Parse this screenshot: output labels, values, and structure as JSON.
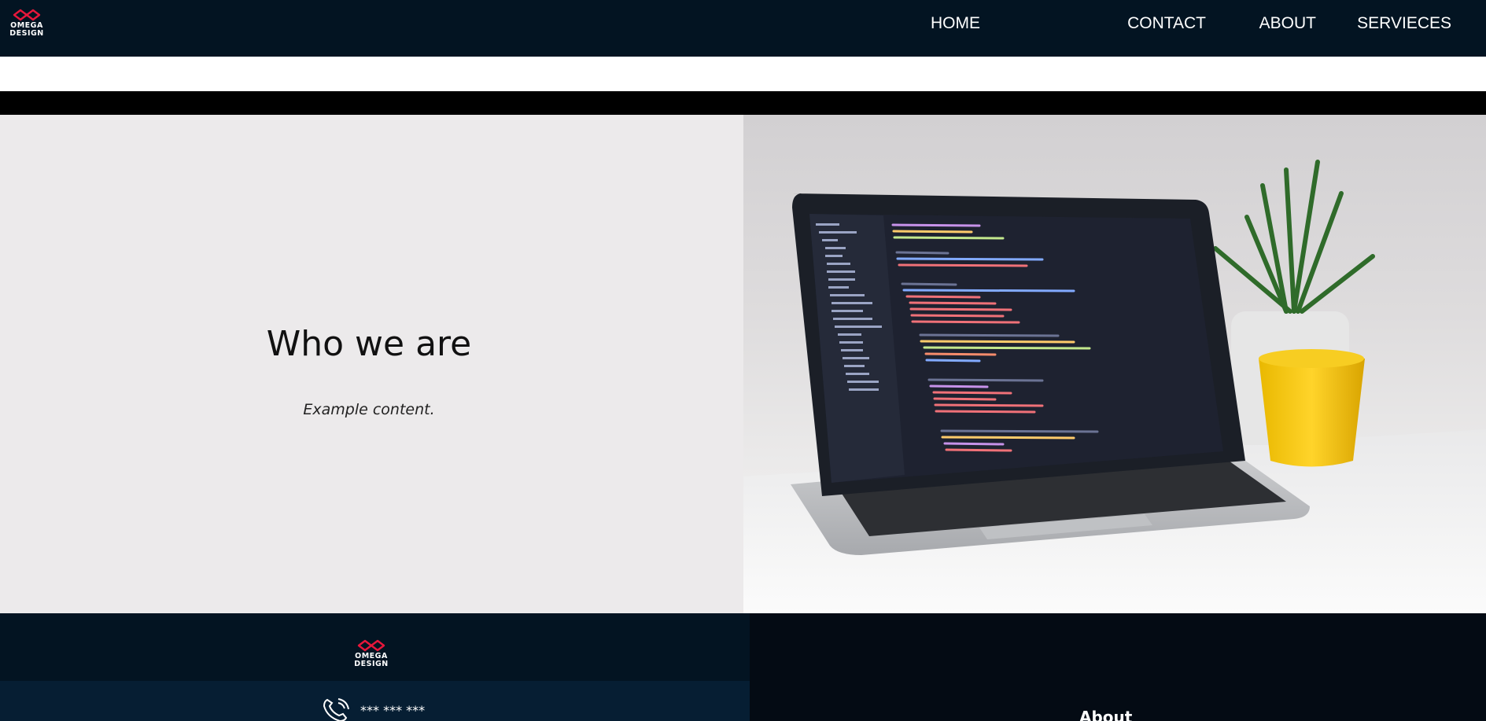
{
  "header": {
    "logo": {
      "line1": "OMEGA",
      "line2": "DESIGN"
    },
    "nav": [
      {
        "label": "HOME"
      },
      {
        "label": "CONTACT"
      },
      {
        "label": "ABOUT"
      },
      {
        "label": "SERVIECES"
      }
    ]
  },
  "hero": {
    "title": "Who we are",
    "subtitle": "Example content.",
    "image_alt": "laptop-with-code"
  },
  "footer": {
    "logo": {
      "line1": "OMEGA",
      "line2": "DESIGN"
    },
    "phone": "*** *** ***",
    "about_heading": "About"
  },
  "colors": {
    "header_bg": "#031422",
    "brand_red": "#e8173b",
    "footer_right_bg": "#040b14",
    "footer_left_bottom_bg": "#061e33"
  }
}
